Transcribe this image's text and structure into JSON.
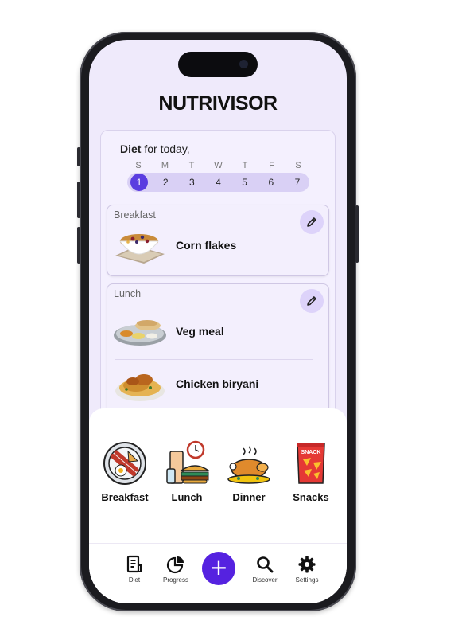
{
  "app": {
    "title": "NUTRIVISOR"
  },
  "diet": {
    "heading_bold": "Diet",
    "heading_rest": " for today,",
    "days": [
      "S",
      "M",
      "T",
      "W",
      "T",
      "F",
      "S"
    ],
    "dates": [
      "1",
      "2",
      "3",
      "4",
      "5",
      "6",
      "7"
    ],
    "selected_date": "1"
  },
  "meals": [
    {
      "label": "Breakfast",
      "items": [
        {
          "name": "Corn flakes",
          "icon": "cereal-bowl"
        }
      ]
    },
    {
      "label": "Lunch",
      "items": [
        {
          "name": "Veg meal",
          "icon": "thali-plate"
        },
        {
          "name": "Chicken biryani",
          "icon": "biryani-plate"
        }
      ]
    }
  ],
  "categories": [
    {
      "label": "Breakfast",
      "icon": "breakfast-plate-icon"
    },
    {
      "label": "Lunch",
      "icon": "lunch-box-icon"
    },
    {
      "label": "Dinner",
      "icon": "roast-chicken-icon"
    },
    {
      "label": "Snacks",
      "icon": "snack-bag-icon"
    }
  ],
  "nav": {
    "diet": "Diet",
    "progress": "Progress",
    "add": "+",
    "discover": "Discover",
    "settings": "Settings"
  },
  "colors": {
    "accent": "#5522e0",
    "screen_bg": "#efeafb",
    "date_pill": "#d9d0f5"
  }
}
